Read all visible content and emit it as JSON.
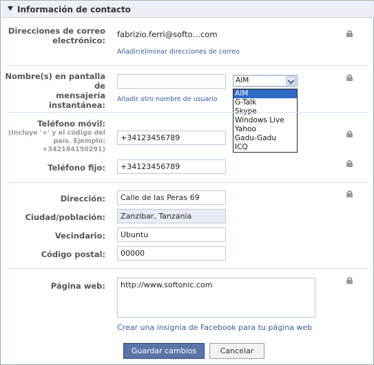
{
  "section": {
    "title": "Información de contacto"
  },
  "email": {
    "label_line1": "Direcciones de correo",
    "label_line2": "electrónico:",
    "value": "fabrizio.ferri@softo…com",
    "link": "Añadir/eliminar direcciones de correo"
  },
  "im": {
    "label_line1": "Nombre(s) en pantalla de",
    "label_line2": "mensajería instantánea:",
    "value": "",
    "selected": "AIM",
    "options": [
      "AIM",
      "G-Talk",
      "Skype",
      "Windows Live",
      "Yahoo",
      "Gadu-Gadu",
      "ICQ"
    ],
    "link": "Añadir otro nombre de usuario"
  },
  "mobile": {
    "label": "Teléfono móvil:",
    "hint_line1": "(Incluye '+' y el código del",
    "hint_line2": "país. Ejemplo:",
    "hint_line3": "+342184150291)",
    "value": "+34123456789"
  },
  "landline": {
    "label": "Teléfono fijo:",
    "value": "+34123456789"
  },
  "address": {
    "label": "Dirección:",
    "value": "Calle de las Peras 69"
  },
  "city": {
    "label": "Ciudad/población:",
    "value": "Zanzibar, Tanzania"
  },
  "neighborhood": {
    "label": "Vecindario:",
    "value": "Ubuntu"
  },
  "postal": {
    "label": "Código postal:",
    "value": "00000"
  },
  "website": {
    "label": "Página web:",
    "value": "http://www.softonic.com",
    "link": "Crear una insignia de Facebook para tu página web"
  },
  "buttons": {
    "save": "Guardar cambios",
    "cancel": "Cancelar"
  },
  "icons": {
    "section_toggle": "triangle-down-icon",
    "privacy": "lock-icon"
  },
  "colors": {
    "link": "#3b5998",
    "primary_button": "#5b74a8",
    "header_bg": "#eceff5",
    "dropdown_highlight": "#316ac5"
  }
}
